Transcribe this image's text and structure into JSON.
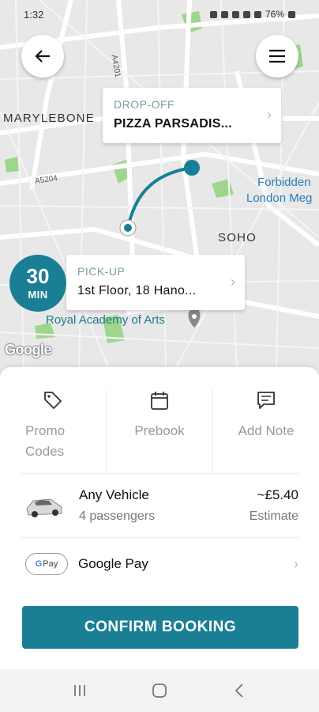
{
  "status_bar": {
    "time": "1:32",
    "battery": "76%"
  },
  "map": {
    "areas": [
      "MARYLEBONE",
      "SOHO"
    ],
    "roads": [
      "A4201",
      "A5204"
    ],
    "poi_forbidden_line1": "Forbidden",
    "poi_forbidden_line2": "London Meg",
    "poi_royal": "Royal Academy of Arts",
    "attribution": "Google"
  },
  "dropoff": {
    "kicker": "DROP-OFF",
    "value": "PIZZA PARSADIS..."
  },
  "pickup": {
    "kicker": "PICK-UP",
    "value": "1st Floor, 18 Hano..."
  },
  "eta": {
    "value": "30",
    "unit": "MIN"
  },
  "options": [
    {
      "line1": "Promo",
      "line2": "Codes",
      "icon": "tag-icon"
    },
    {
      "line1": "Prebook",
      "icon": "calendar-icon"
    },
    {
      "line1": "Add Note",
      "icon": "note-icon"
    }
  ],
  "vehicle": {
    "title": "Any Vehicle",
    "subtitle": "4 passengers",
    "price": "~£5.40",
    "price_sub": "Estimate"
  },
  "payment": {
    "badge_g": "G",
    "badge_text": "Pay",
    "label": "Google Pay"
  },
  "confirm_label": "CONFIRM BOOKING",
  "colors": {
    "brand": "#1a7f94",
    "park": "#9fd68e",
    "road": "#ffffff"
  }
}
